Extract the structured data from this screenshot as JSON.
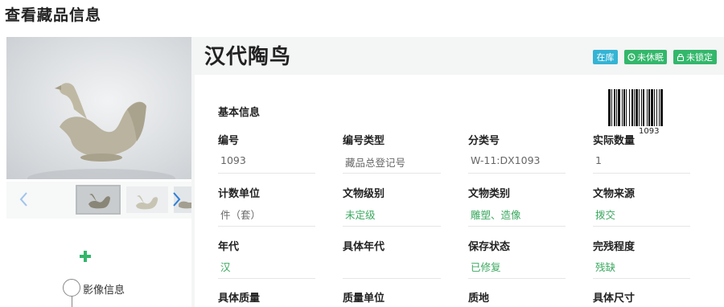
{
  "page": {
    "title": "查看藏品信息"
  },
  "item": {
    "name": "汉代陶鸟",
    "badges": {
      "stock": "在库",
      "sleep": "未休眠",
      "lock": "未锁定"
    }
  },
  "gallery": {
    "timeline_label": "影像信息"
  },
  "barcode": {
    "number": "1093"
  },
  "basic_info": {
    "title": "基本信息",
    "fields": [
      {
        "label": "编号",
        "value": "1093"
      },
      {
        "label": "编号类型",
        "value": "藏品总登记号"
      },
      {
        "label": "分类号",
        "value": "W-11:DX1093"
      },
      {
        "label": "实际数量",
        "value": "1"
      },
      {
        "label": "计数单位",
        "value": "件（套）"
      },
      {
        "label": "文物级别",
        "value": "未定级"
      },
      {
        "label": "文物类别",
        "value": "雕塑、造像"
      },
      {
        "label": "文物来源",
        "value": "拨交"
      },
      {
        "label": "年代",
        "value": "汉"
      },
      {
        "label": "具体年代",
        "value": ""
      },
      {
        "label": "保存状态",
        "value": "已修复"
      },
      {
        "label": "完残程度",
        "value": "残缺"
      },
      {
        "label": "具体质量",
        "value": ""
      },
      {
        "label": "质量单位",
        "value": ""
      },
      {
        "label": "质地",
        "value": ""
      },
      {
        "label": "具体尺寸",
        "value": ""
      }
    ]
  },
  "colors": {
    "accent_green": "#33b76b",
    "accent_blue": "#34b4d4",
    "value_green": "#3aa85f"
  }
}
